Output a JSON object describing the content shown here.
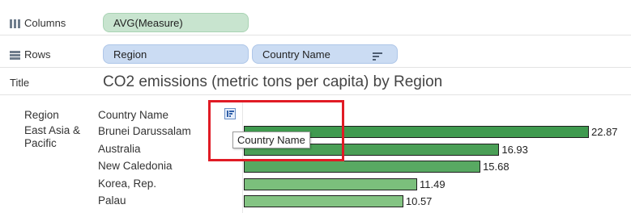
{
  "shelves": {
    "columns": {
      "label": "Columns",
      "pill": "AVG(Measure)"
    },
    "rows": {
      "label": "Rows",
      "pills": [
        "Region",
        "Country Name"
      ]
    }
  },
  "title_shelf": {
    "label": "Title",
    "text": "CO2 emissions (metric tons per capita) by Region"
  },
  "view": {
    "header_region": "Region",
    "header_country": "Country Name",
    "region": "East Asia & Pacific",
    "region_lines": [
      "East Asia &",
      "Pacific"
    ],
    "tooltip": "Country Name",
    "sort_icon": "sort-descending-icon"
  },
  "chart_data": {
    "type": "bar",
    "orientation": "horizontal",
    "categories": [
      "Brunei Darussalam",
      "Australia",
      "New Caledonia",
      "Korea, Rep.",
      "Palau"
    ],
    "values": [
      22.87,
      16.93,
      15.68,
      11.49,
      10.57
    ],
    "value_labels": [
      "22.87",
      "16.93",
      "15.68",
      "11.49",
      "10.57"
    ],
    "colors": [
      "#3f9a4f",
      "#4a9f56",
      "#58a962",
      "#7bbf7c",
      "#84c483"
    ]
  },
  "colors": {
    "column_pill": "#c8e4cf",
    "row_pill": "#cbdcf3",
    "highlight": "#e01b25"
  }
}
